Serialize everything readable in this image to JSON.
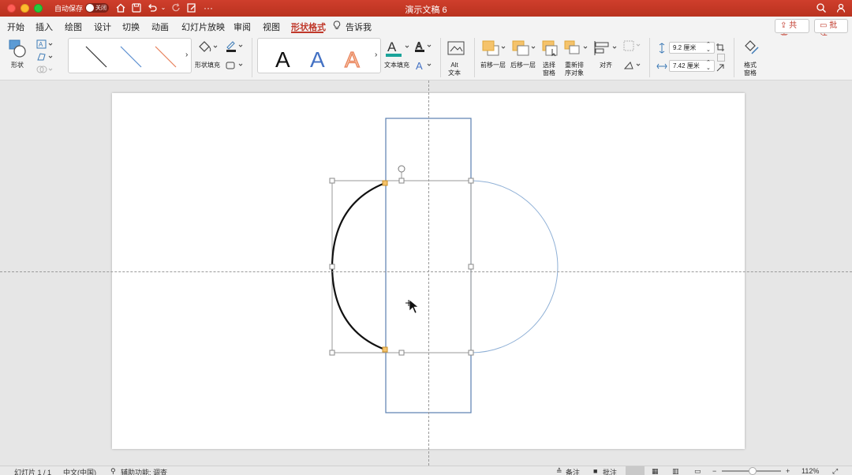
{
  "titlebar": {
    "autosave_label": "自动保存",
    "autosave_state": "关闭",
    "doc_title": "演示文稿 6"
  },
  "tabs": [
    {
      "label": "开始"
    },
    {
      "label": "插入"
    },
    {
      "label": "绘图"
    },
    {
      "label": "设计"
    },
    {
      "label": "切换"
    },
    {
      "label": "动画"
    },
    {
      "label": "幻灯片放映"
    },
    {
      "label": "审阅"
    },
    {
      "label": "视图"
    },
    {
      "label": "形状格式"
    },
    {
      "label": "告诉我"
    }
  ],
  "share_label": "共享",
  "comment_label": "批注",
  "ribbon": {
    "shape_label": "形状",
    "shape_fill_label": "形状填充",
    "text_fill_label": "文本填充",
    "alt_text_label": "Alt\n文本",
    "bring_forward_label": "前移一层",
    "send_backward_label": "后移一层",
    "selection_pane_label": "选择\n窗格",
    "reorder_label": "重新排\n序对象",
    "align_label": "对齐",
    "height_value": "9.2 厘米",
    "width_value": "7.42 厘米",
    "format_pane_label": "格式\n窗格",
    "wordart_letter": "A"
  },
  "status": {
    "slide_info": "幻灯片 1 / 1",
    "language": "中文(中国)",
    "accessibility": "辅助功能: 调查",
    "notes_label": "备注",
    "comments_label": "批注",
    "zoom": "112%"
  },
  "colors": {
    "accent": "#c0392b",
    "shape_outline": "#5b7fb0",
    "circle_outline": "#8fb0d6"
  }
}
